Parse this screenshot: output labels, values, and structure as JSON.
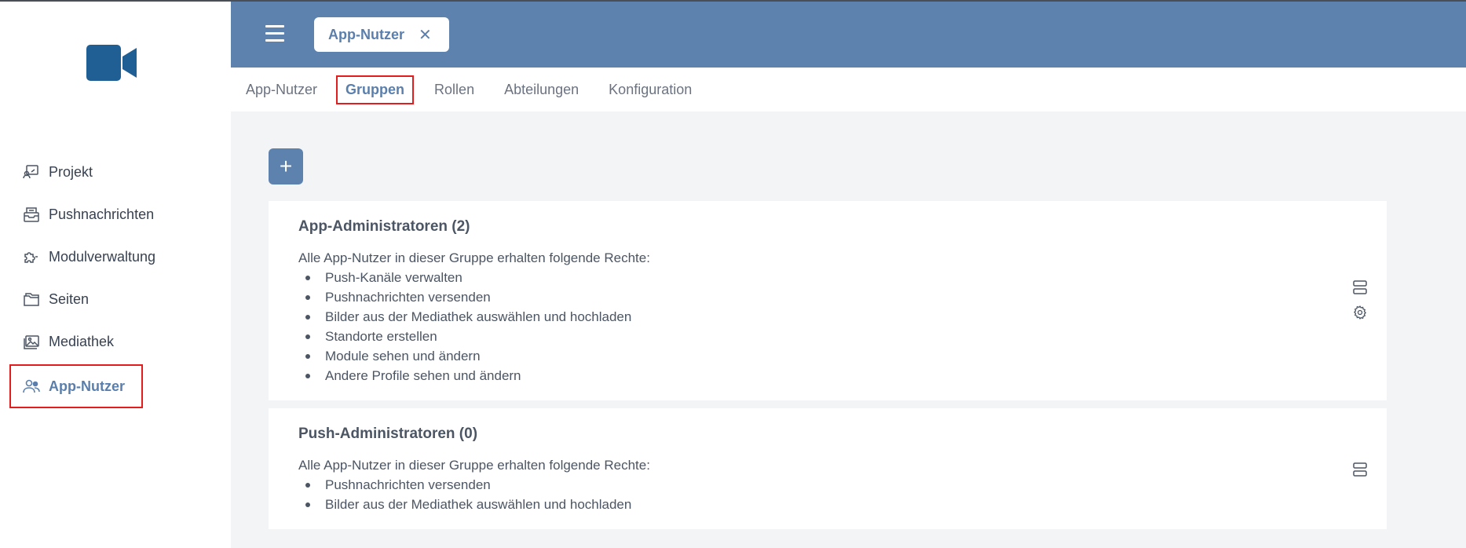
{
  "app": {
    "open_tab": "App-Nutzer",
    "close_glyph": "✕"
  },
  "sidebar": {
    "items": [
      {
        "label": "Projekt",
        "icon": "project-icon"
      },
      {
        "label": "Pushnachrichten",
        "icon": "push-messages-icon"
      },
      {
        "label": "Modulverwaltung",
        "icon": "puzzle-icon"
      },
      {
        "label": "Seiten",
        "icon": "pages-icon"
      },
      {
        "label": "Mediathek",
        "icon": "image-icon"
      },
      {
        "label": "App-Nutzer",
        "icon": "users-icon",
        "active": true
      }
    ]
  },
  "subnav": {
    "tabs": [
      "App-Nutzer",
      "Gruppen",
      "Rollen",
      "Abteilungen",
      "Konfiguration"
    ],
    "active": "Gruppen"
  },
  "toolbar": {
    "add_label": "+"
  },
  "groups": [
    {
      "title": "App-Administratoren (2)",
      "intro": "Alle App-Nutzer in dieser Gruppe erhalten folgende Rechte:",
      "rights": [
        "Push-Kanäle verwalten",
        "Pushnachrichten versenden",
        "Bilder aus der Mediathek auswählen und hochladen",
        "Standorte erstellen",
        "Module sehen und ändern",
        "Andere Profile sehen und ändern"
      ]
    },
    {
      "title": "Push-Administratoren (0)",
      "intro": "Alle App-Nutzer in dieser Gruppe erhalten folgende Rechte:",
      "rights": [
        "Pushnachrichten versenden",
        "Bilder aus der Mediathek auswählen und hochladen"
      ]
    }
  ],
  "colors": {
    "brand": "#5d82ad",
    "logo": "#1f5f93",
    "highlight": "#e11d1d"
  }
}
